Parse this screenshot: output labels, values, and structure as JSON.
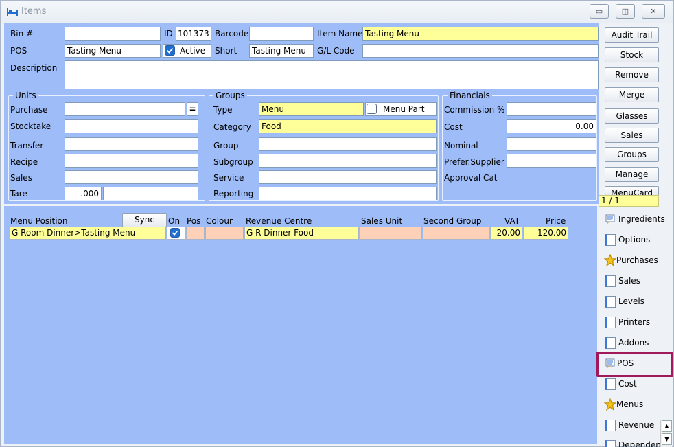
{
  "window": {
    "title": "Items",
    "controls": {
      "minimize": "▭",
      "maximize": "◫",
      "close": "✕"
    }
  },
  "header": {
    "bin_label": "Bin #",
    "bin_value": "",
    "id_label": "ID",
    "id_value": "101373",
    "barcode_label": "Barcode",
    "barcode_value": "",
    "item_name_label": "Item Name",
    "item_name_value": "Tasting Menu",
    "pos_label": "POS",
    "pos_value": "Tasting Menu",
    "active_label": "Active",
    "short_label": "Short",
    "short_value": "Tasting Menu",
    "gl_code_label": "G/L Code",
    "gl_code_value": "",
    "description_label": "Description",
    "description_value": ""
  },
  "units": {
    "title": "Units",
    "purchase_label": "Purchase",
    "purchase_value": "",
    "eq_button": "=",
    "stocktake_label": "Stocktake",
    "transfer_label": "Transfer",
    "recipe_label": "Recipe",
    "sales_label": "Sales",
    "tare_label": "Tare",
    "tare_value": ".000"
  },
  "groups": {
    "title": "Groups",
    "type_label": "Type",
    "type_value": "Menu",
    "menu_part_label": "Menu Part",
    "category_label": "Category",
    "category_value": "Food",
    "group_label": "Group",
    "subgroup_label": "Subgroup",
    "service_label": "Service",
    "reporting_label": "Reporting"
  },
  "financials": {
    "title": "Financials",
    "commission_label": "Commission %",
    "cost_label": "Cost",
    "cost_value": "0.00",
    "nominal_label": "Nominal",
    "prefer_supplier_label": "Prefer.Supplier",
    "approval_cat_label": "Approval Cat"
  },
  "side_buttons": [
    "Audit Trail",
    "Stock",
    "Remove",
    "Merge",
    "Glasses",
    "Sales",
    "Groups",
    "Manage",
    "MenuCard"
  ],
  "record_counter": "1 / 1",
  "table": {
    "sync_button": "Sync",
    "columns": [
      "Menu Position",
      "On",
      "Pos",
      "Colour",
      "Revenue Centre",
      "Sales Unit",
      "Second Group",
      "VAT",
      "Price"
    ],
    "rows": [
      {
        "menu_position": "G Room Dinner>Tasting Menu",
        "pos": "",
        "colour": "",
        "revenue_centre": "G R Dinner Food",
        "sales_unit": "",
        "second_group": "",
        "vat": "20.00",
        "price": "120.00"
      }
    ]
  },
  "nav": {
    "items": [
      {
        "label": "Ingredients",
        "icon": "notes-icon"
      },
      {
        "label": "Options",
        "icon": "document-icon"
      },
      {
        "label": "Purchases",
        "icon": "star-icon"
      },
      {
        "label": "Sales",
        "icon": "document-icon"
      },
      {
        "label": "Levels",
        "icon": "document-icon"
      },
      {
        "label": "Printers",
        "icon": "document-icon"
      },
      {
        "label": "Addons",
        "icon": "document-icon"
      },
      {
        "label": "POS",
        "icon": "notes-icon"
      },
      {
        "label": "Cost",
        "icon": "document-icon"
      },
      {
        "label": "Menus",
        "icon": "star-icon"
      },
      {
        "label": "Revenue",
        "icon": "document-icon"
      },
      {
        "label": "Dependencies",
        "icon": "document-icon"
      }
    ],
    "selected_index": 7,
    "highlight_color": "#a0195a"
  }
}
